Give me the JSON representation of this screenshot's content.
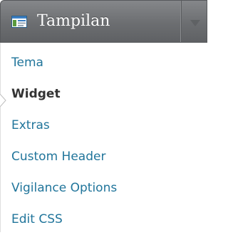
{
  "menu": {
    "title": "Tampilan",
    "items": [
      {
        "label": "Tema",
        "current": false
      },
      {
        "label": "Widget",
        "current": true
      },
      {
        "label": "Extras",
        "current": false
      },
      {
        "label": "Custom Header",
        "current": false
      },
      {
        "label": "Vigilance Options",
        "current": false
      },
      {
        "label": "Edit CSS",
        "current": false
      }
    ]
  },
  "colors": {
    "header_bg": "#6c6e71",
    "link": "#21759b",
    "current_text": "#333333"
  },
  "icons": {
    "header": "appearance-icon",
    "toggle": "arrow-down-icon",
    "current_marker": "current-arrow-icon"
  }
}
